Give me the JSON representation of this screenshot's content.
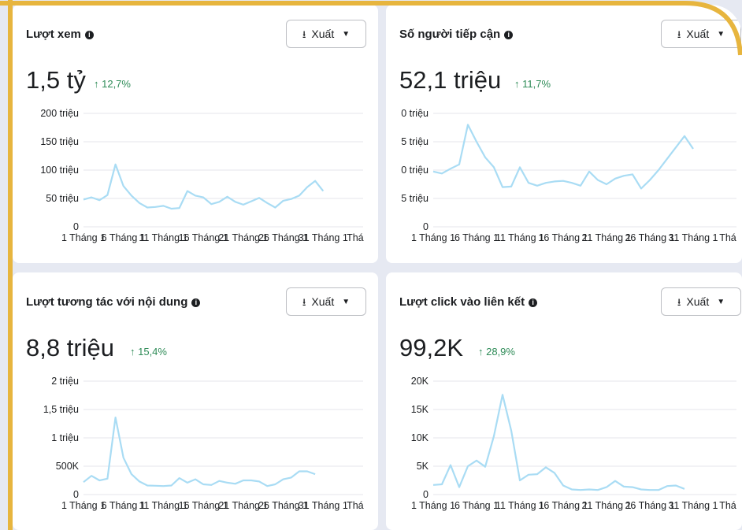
{
  "cards": [
    {
      "title": "Lượt xem",
      "export_label": "Xuất",
      "value": "1,5 tỷ",
      "delta": "↑ 12,7%"
    },
    {
      "title": "Số người tiếp cận",
      "export_label": "Xuất",
      "value": "52,1 triệu",
      "delta": "↑ 11,7%"
    },
    {
      "title": "Lượt tương tác với nội dung",
      "export_label": "Xuất",
      "value": "8,8 triệu",
      "delta": "↑ 15,4%"
    },
    {
      "title": "Lượt click vào liên kết",
      "export_label": "Xuất",
      "value": "99,2K",
      "delta": "↑ 28,9%"
    }
  ],
  "colors": {
    "accent_frame": "#e7b53e",
    "line": "#a9dcf4",
    "delta_up": "#2e8b57"
  },
  "icons": {
    "info": "info-icon",
    "export": "download-icon",
    "dropdown": "caret-down-icon"
  },
  "chart_data": [
    {
      "type": "line",
      "ylim": [
        0,
        200
      ],
      "y_ticks": [
        "0",
        "50 triệu",
        "100 triệu",
        "150 triệu",
        "200 triệu"
      ],
      "x_ticks": [
        "1 Tháng 1",
        "6 Tháng 1",
        "11 Tháng 1",
        "16 Tháng 1",
        "21 Tháng 1",
        "26 Tháng 1",
        "31 Tháng 1",
        "Thá"
      ],
      "x_tick_pos": [
        1,
        6,
        11,
        16,
        21,
        26,
        31,
        35
      ],
      "x": [
        1,
        2,
        3,
        4,
        5,
        6,
        7,
        8,
        9,
        10,
        11,
        12,
        13,
        14,
        15,
        16,
        17,
        18,
        19,
        20,
        21,
        22,
        23,
        24,
        25,
        26,
        27,
        28,
        29,
        30,
        31,
        32,
        33,
        34,
        35,
        36
      ],
      "values": [
        48,
        52,
        47,
        56,
        110,
        72,
        55,
        42,
        34,
        35,
        37,
        32,
        33,
        63,
        55,
        52,
        40,
        44,
        53,
        44,
        39,
        45,
        51,
        42,
        34,
        46,
        49,
        55,
        70,
        81,
        63
      ]
    },
    {
      "type": "line",
      "ylim": [
        0,
        4
      ],
      "y_ticks": [
        "0",
        "5 triệu",
        "0 triệu",
        "5 triệu",
        "0 triệu"
      ],
      "x_ticks": [
        "1 Tháng 1",
        "6 Tháng 1",
        "11 Tháng 1",
        "16 Tháng 1",
        "21 Tháng 1",
        "26 Tháng 1",
        "31 Tháng 1",
        "Thá"
      ],
      "x_tick_pos": [
        1,
        6,
        11,
        16,
        21,
        26,
        31,
        35
      ],
      "x": [
        1,
        2,
        3,
        4,
        5,
        6,
        7,
        8,
        9,
        10,
        11,
        12,
        13,
        14,
        15,
        16,
        17,
        18,
        19,
        20,
        21,
        22,
        23,
        24,
        25,
        26,
        27,
        28,
        29,
        30,
        31,
        32
      ],
      "values": [
        1.95,
        1.88,
        2.05,
        2.2,
        3.6,
        3.0,
        2.45,
        2.1,
        1.4,
        1.42,
        2.1,
        1.55,
        1.45,
        1.55,
        1.6,
        1.62,
        1.55,
        1.45,
        1.95,
        1.65,
        1.5,
        1.7,
        1.8,
        1.85,
        1.35,
        1.65,
        2.0,
        2.4,
        2.8,
        3.2,
        2.75
      ]
    },
    {
      "type": "line",
      "ylim": [
        0,
        2000
      ],
      "y_ticks": [
        "0",
        "500K",
        "1 triệu",
        "1,5 triệu",
        "2 triệu"
      ],
      "x_ticks": [
        "1 Tháng 1",
        "6 Tháng 1",
        "11 Tháng 1",
        "16 Tháng 1",
        "21 Tháng 1",
        "26 Tháng 1",
        "31 Tháng 1",
        "Thá"
      ],
      "x_tick_pos": [
        1,
        6,
        11,
        16,
        21,
        26,
        31,
        35
      ],
      "x": [
        1,
        2,
        3,
        4,
        5,
        6,
        7,
        8,
        9,
        10,
        11,
        12,
        13,
        14,
        15,
        16,
        17,
        18,
        19,
        20,
        21,
        22,
        23,
        24,
        25,
        26,
        27,
        28,
        29,
        30,
        31
      ],
      "values": [
        220,
        330,
        250,
        280,
        1360,
        650,
        360,
        230,
        160,
        155,
        150,
        160,
        290,
        210,
        270,
        180,
        170,
        240,
        210,
        190,
        250,
        250,
        230,
        150,
        180,
        270,
        300,
        410,
        410,
        360
      ]
    },
    {
      "type": "line",
      "ylim": [
        0,
        20000
      ],
      "y_ticks": [
        "0",
        "5K",
        "10K",
        "15K",
        "20K"
      ],
      "x_ticks": [
        "1 Tháng 1",
        "6 Tháng 1",
        "11 Tháng 1",
        "16 Tháng 1",
        "21 Tháng 1",
        "26 Tháng 1",
        "31 Tháng 1",
        "Thá"
      ],
      "x_tick_pos": [
        1,
        6,
        11,
        16,
        21,
        26,
        31,
        35
      ],
      "x": [
        1,
        2,
        3,
        4,
        5,
        6,
        7,
        8,
        9,
        10,
        11,
        12,
        13,
        14,
        15,
        16,
        17,
        18,
        19,
        20,
        21,
        22,
        23,
        24,
        25,
        26,
        27,
        28,
        29,
        30,
        31
      ],
      "values": [
        1700,
        1800,
        5200,
        1300,
        5000,
        6000,
        4900,
        10300,
        17600,
        11300,
        2500,
        3500,
        3600,
        4800,
        3800,
        1600,
        900,
        800,
        900,
        800,
        1300,
        2400,
        1400,
        1300,
        900,
        800,
        800,
        1500,
        1600,
        1000
      ]
    }
  ]
}
